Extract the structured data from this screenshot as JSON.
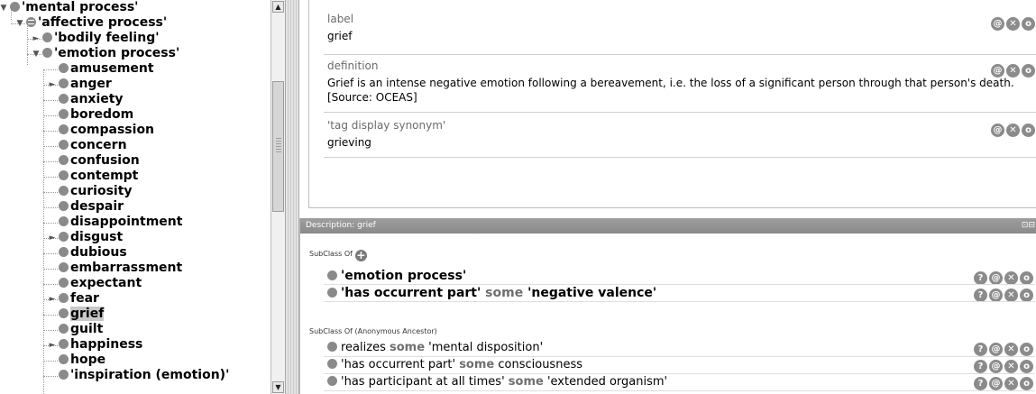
{
  "tree": {
    "items": [
      {
        "label": "'mental process'",
        "toggle": "expanded",
        "icon": "class-dot"
      },
      {
        "label": "'affective process'",
        "toggle": "expanded",
        "icon": "defined-class-dot"
      },
      {
        "label": "'bodily feeling'",
        "toggle": "collapsed",
        "icon": "class-dot"
      },
      {
        "label": "'emotion process'",
        "toggle": "expanded",
        "icon": "class-dot"
      },
      {
        "label": "amusement",
        "toggle": "none",
        "icon": "class-dot"
      },
      {
        "label": "anger",
        "toggle": "collapsed",
        "icon": "class-dot"
      },
      {
        "label": "anxiety",
        "toggle": "none",
        "icon": "class-dot"
      },
      {
        "label": "boredom",
        "toggle": "none",
        "icon": "class-dot"
      },
      {
        "label": "compassion",
        "toggle": "none",
        "icon": "class-dot"
      },
      {
        "label": "concern",
        "toggle": "none",
        "icon": "class-dot"
      },
      {
        "label": "confusion",
        "toggle": "none",
        "icon": "class-dot"
      },
      {
        "label": "contempt",
        "toggle": "none",
        "icon": "class-dot"
      },
      {
        "label": "curiosity",
        "toggle": "none",
        "icon": "class-dot"
      },
      {
        "label": "despair",
        "toggle": "none",
        "icon": "class-dot"
      },
      {
        "label": "disappointment",
        "toggle": "none",
        "icon": "class-dot"
      },
      {
        "label": "disgust",
        "toggle": "collapsed",
        "icon": "class-dot"
      },
      {
        "label": "dubious",
        "toggle": "none",
        "icon": "class-dot"
      },
      {
        "label": "embarrassment",
        "toggle": "none",
        "icon": "class-dot"
      },
      {
        "label": "expectant",
        "toggle": "none",
        "icon": "class-dot"
      },
      {
        "label": "fear",
        "toggle": "collapsed",
        "icon": "class-dot"
      },
      {
        "label": "grief",
        "toggle": "none",
        "icon": "class-dot",
        "selected": true
      },
      {
        "label": "guilt",
        "toggle": "none",
        "icon": "class-dot"
      },
      {
        "label": "happiness",
        "toggle": "collapsed",
        "icon": "class-dot"
      },
      {
        "label": "hope",
        "toggle": "none",
        "icon": "class-dot"
      },
      {
        "label": "'inspiration (emotion)'",
        "toggle": "none",
        "icon": "class-dot"
      }
    ],
    "scroll_up_glyph": "▲",
    "scroll_down_glyph": "▼"
  },
  "annotations": [
    {
      "property": "label",
      "value": "grief"
    },
    {
      "property": "definition",
      "value": "Grief is an intense negative emotion following a bereavement, i.e. the loss of a significant person through that person's death.",
      "value_line2": "[Source: OCEAS]"
    },
    {
      "property": "'tag display synonym'",
      "value": "grieving"
    }
  ],
  "annotation_buttons": {
    "annotate": "@",
    "delete": "✕",
    "edit": "o"
  },
  "description": {
    "header": "Description: grief",
    "pin_glyph": "⊡⊟",
    "add_glyph": "+",
    "sections": [
      {
        "title": "SubClass Of",
        "axioms": [
          {
            "parts": [
              {
                "t": "'emotion process'",
                "kw": false
              }
            ]
          },
          {
            "parts": [
              {
                "t": "'has occurrent part' ",
                "kw": false
              },
              {
                "t": "some",
                "kw": true
              },
              {
                "t": " 'negative valence'",
                "kw": false
              }
            ]
          }
        ]
      },
      {
        "title": "SubClass Of (Anonymous Ancestor)",
        "axioms": [
          {
            "parts": [
              {
                "t": "realizes ",
                "kw": false
              },
              {
                "t": "some",
                "kw": true
              },
              {
                "t": " 'mental disposition'",
                "kw": false
              }
            ]
          },
          {
            "parts": [
              {
                "t": "'has occurrent part' ",
                "kw": false
              },
              {
                "t": "some",
                "kw": true
              },
              {
                "t": " consciousness",
                "kw": false
              }
            ]
          },
          {
            "parts": [
              {
                "t": "'has participant at all times' ",
                "kw": false
              },
              {
                "t": "some",
                "kw": true
              },
              {
                "t": " 'extended organism'",
                "kw": false
              }
            ]
          }
        ]
      }
    ],
    "axiom_buttons": {
      "explain": "?",
      "annotate": "@",
      "delete": "✕",
      "edit": "o"
    }
  },
  "colors": {
    "accent_gray": "#8a8a8a",
    "keyword": "#6f6f6f",
    "selection": "#c8c8c8"
  }
}
